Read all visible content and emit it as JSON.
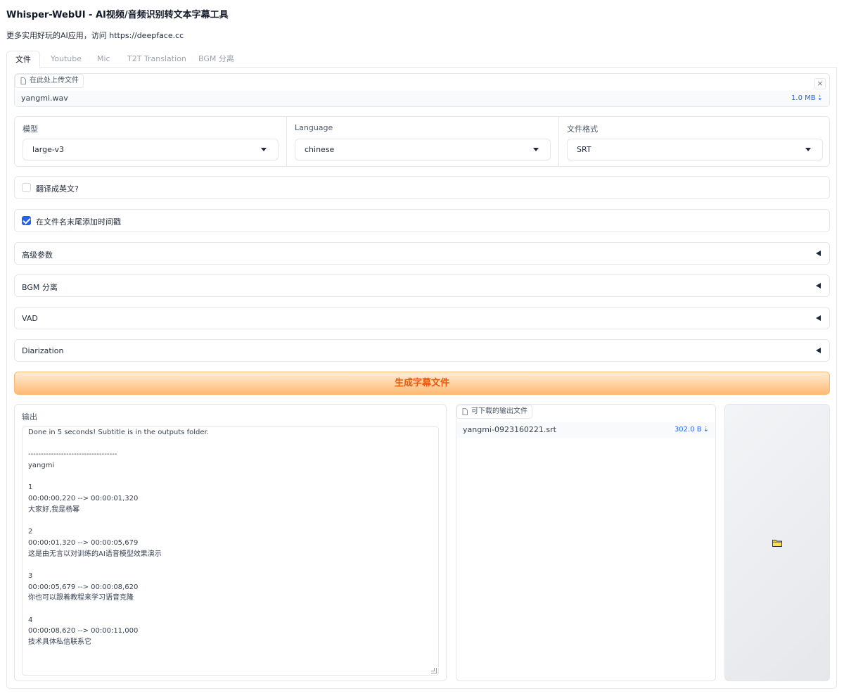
{
  "app": {
    "title": "Whisper-WebUI - AI视频/音频识别转文本字幕工具",
    "subtitle": "更多实用好玩的AI应用，访问 https://deepface.cc"
  },
  "tabs": [
    {
      "label": "文件",
      "active": true
    },
    {
      "label": "Youtube",
      "active": false
    },
    {
      "label": "Mic",
      "active": false
    },
    {
      "label": "T2T Translation",
      "active": false
    },
    {
      "label": "BGM 分离",
      "active": false
    }
  ],
  "upload": {
    "chip_label": "在此处上传文件",
    "file_name": "yangmi.wav",
    "file_size": "1.0 MB",
    "download_glyph": "⇣",
    "close_glyph": "×"
  },
  "dropdowns": {
    "model": {
      "label": "模型",
      "value": "large-v3"
    },
    "language": {
      "label": "Language",
      "value": "chinese"
    },
    "format": {
      "label": "文件格式",
      "value": "SRT"
    }
  },
  "checkboxes": {
    "translate": {
      "label": "翻译成英文?",
      "checked": false
    },
    "timestamp": {
      "label": "在文件名末尾添加时间戳",
      "checked": true
    }
  },
  "accordions": [
    {
      "label": "高级参数"
    },
    {
      "label": "BGM 分离"
    },
    {
      "label": "VAD"
    },
    {
      "label": "Diarization"
    }
  ],
  "generate_button": {
    "label": "生成字幕文件"
  },
  "output": {
    "label": "输出",
    "lines": [
      "Done in 5 seconds! Subtitle is in the outputs folder.",
      "",
      "-----------------------------------",
      "yangmi",
      "",
      "1",
      "00:00:00,220 --> 00:00:01,320",
      "大家好,我是杨幂",
      "",
      "2",
      "00:00:01,320 --> 00:00:05,679",
      "这是由无言以对训练的AI语音模型效果演示",
      "",
      "3",
      "00:00:05,679 --> 00:00:08,620",
      "你也可以跟着教程来学习语音克隆",
      "",
      "4",
      "00:00:08,620 --> 00:00:11,000",
      "技术具体私信联系它"
    ]
  },
  "downloads": {
    "chip_label": "可下载的输出文件",
    "file_name": "yangmi-0923160221.srt",
    "file_size": "302.0 B",
    "download_glyph": "⇣"
  },
  "colors": {
    "accent": "#2563eb",
    "button_text": "#ea580c",
    "button_bg": "#fdba74"
  }
}
